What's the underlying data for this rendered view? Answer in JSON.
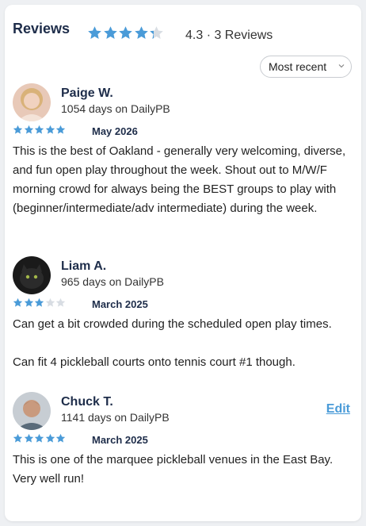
{
  "header": {
    "title": "Reviews",
    "rating_text": "4.3 · 3 Reviews",
    "rating_value": 4.3,
    "star_color": "#4a9bd8",
    "empty_star_color": "#d8dde3"
  },
  "sort": {
    "selected": "Most recent",
    "icon": "chevron-down-icon"
  },
  "reviews": [
    {
      "name": "Paige W.",
      "days": "1054 days on DailyPB",
      "rating": 5,
      "date": "May 2026",
      "text": "This is the best of Oakland - generally very welcoming, diverse, and fun open play throughout the week. Shout out to M/W/F morning crowd for always being the BEST groups to play with (beginner/intermediate/adv intermediate) during the week."
    },
    {
      "name": "Liam A.",
      "days": "965 days on DailyPB",
      "rating": 3,
      "date": "March 2025",
      "text": "Can get a bit crowded during the scheduled open play times.\n\nCan fit 4 pickleball courts onto tennis court #1 though."
    },
    {
      "name": "Chuck T.",
      "days": "1141 days on DailyPB",
      "rating": 5,
      "date": "March 2025",
      "text": "This is one of the marquee pickleball venues in the East Bay. Very well run!",
      "edit_label": "Edit"
    }
  ]
}
